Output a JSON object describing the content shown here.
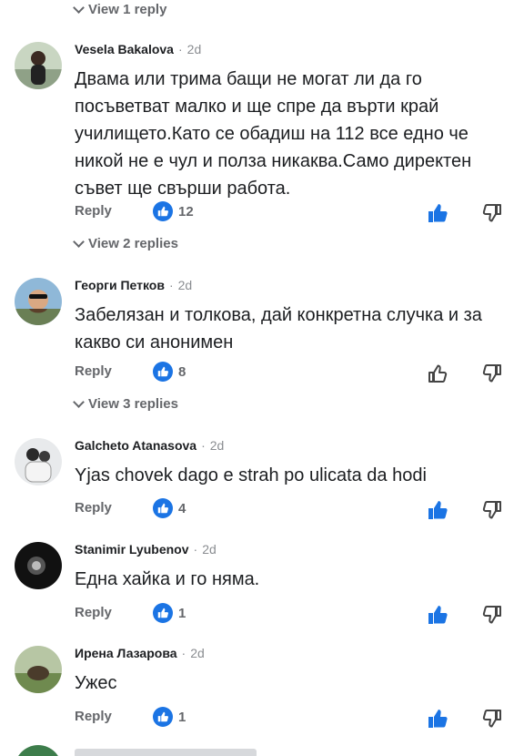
{
  "top_reply_link": "View 1 reply",
  "comments": [
    {
      "author": "Vesela Bakalova",
      "time": "2d",
      "text": "Двама или трима бащи не могат ли да го посъветват малко и ще спре да върти край училището.Като се обадиш на 112 все едно че никой не е чул и полза никаква.Само директен съвет ще свърши работа.",
      "reply_label": "Reply",
      "reaction_count": "12",
      "liked": true,
      "replies_link": "View 2 replies"
    },
    {
      "author": "Георги Петков",
      "time": "2d",
      "text": "Забелязан и толкова, дай конкретна случка и за какво си анонимен",
      "reply_label": "Reply",
      "reaction_count": "8",
      "liked": false,
      "replies_link": "View 3 replies"
    },
    {
      "author": "Galcheto Atanasova",
      "time": "2d",
      "text": "Yjas chovek dago e strah po ulicata da hodi",
      "reply_label": "Reply",
      "reaction_count": "4",
      "liked": true
    },
    {
      "author": "Stanimir Lyubenov",
      "time": "2d",
      "text": "Една хайка и го няма.",
      "reply_label": "Reply",
      "reaction_count": "1",
      "liked": true
    },
    {
      "author": "Ирена Лазарова",
      "time": "2d",
      "text": "Ужес",
      "reply_label": "Reply",
      "reaction_count": "1",
      "liked": true
    }
  ],
  "colors": {
    "accent": "#1b74e4",
    "muted": "#65676b",
    "text": "#1c1e21"
  }
}
